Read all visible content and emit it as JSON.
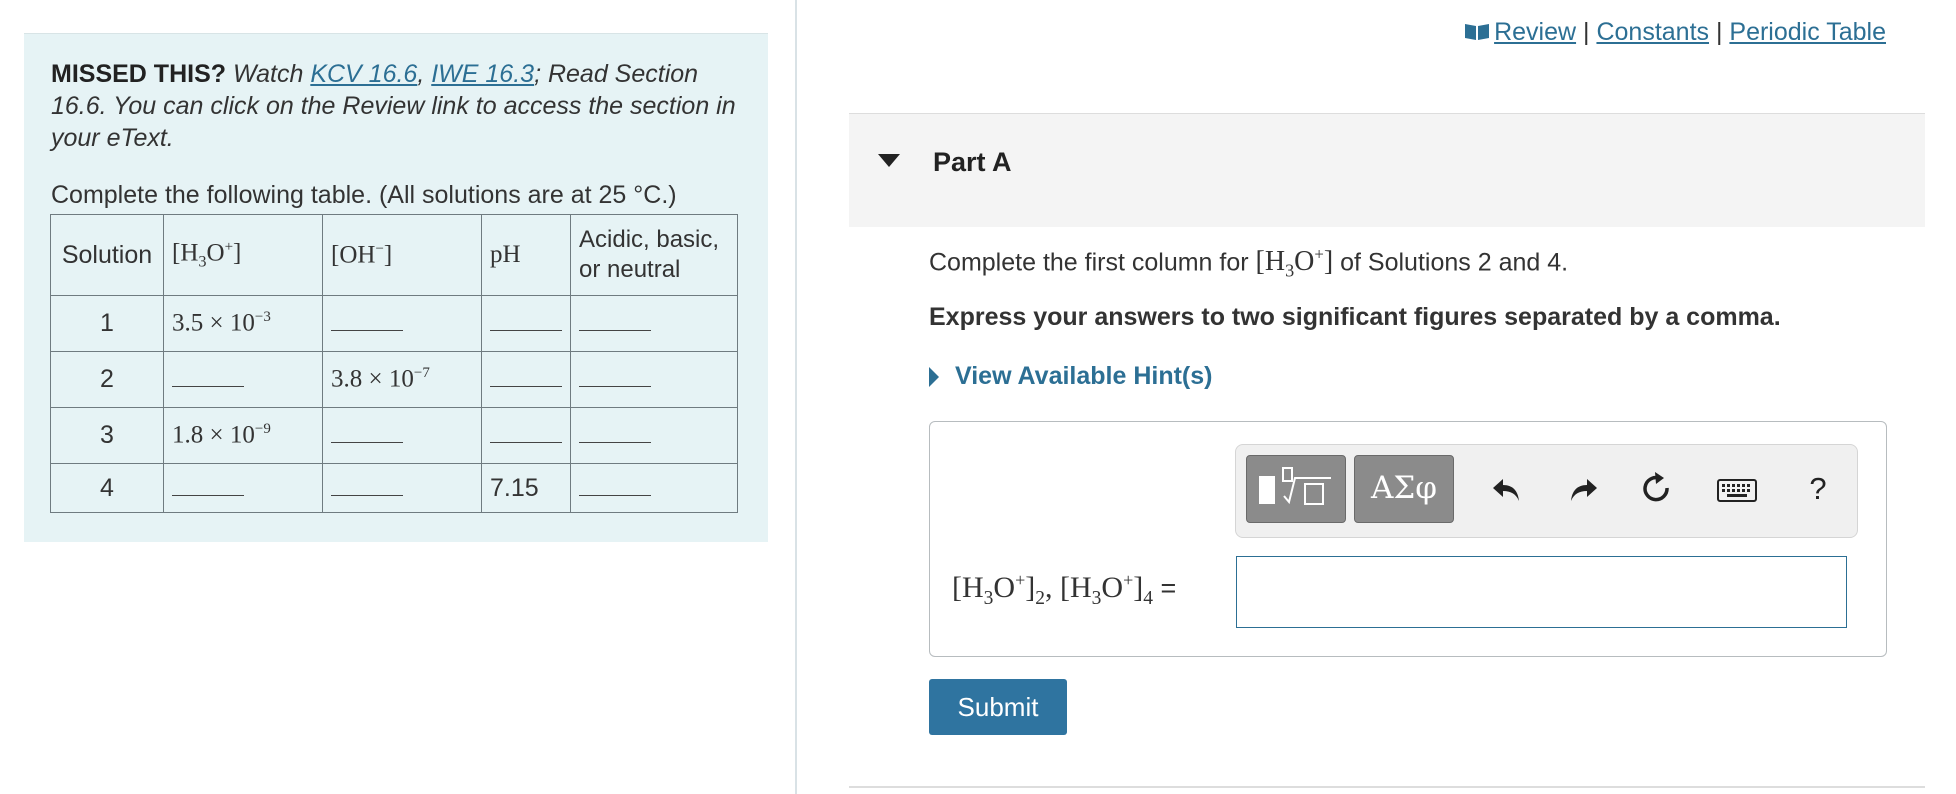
{
  "missed": {
    "prefix": "MISSED THIS?",
    "watch": " Watch ",
    "link1": "KCV 16.6",
    "sep": ", ",
    "link2": "IWE 16.3",
    "rest": "; Read Section 16.6. You can click on the Review link to access the section in your eText."
  },
  "instruction": "Complete the following table. (All solutions are at 25 °C.)",
  "table": {
    "headers": {
      "solution": "Solution",
      "h3o": "[H3O+]",
      "oh": "[OH−]",
      "ph": "pH",
      "acid": "Acidic, basic, or neutral"
    },
    "rows": [
      {
        "solution": "1",
        "h3o": "3.5 × 10−3",
        "oh": "",
        "ph": "",
        "acid": ""
      },
      {
        "solution": "2",
        "h3o": "",
        "oh": "3.8 × 10−7",
        "ph": "",
        "acid": ""
      },
      {
        "solution": "3",
        "h3o": "1.8 × 10−9",
        "oh": "",
        "ph": "",
        "acid": ""
      },
      {
        "solution": "4",
        "h3o": "",
        "oh": "",
        "ph": "7.15",
        "acid": ""
      }
    ]
  },
  "top_links": {
    "review": "Review",
    "constants": "Constants",
    "periodic": "Periodic Table",
    "sep": " | "
  },
  "part": {
    "title": "Part A"
  },
  "question": {
    "prefix": "Complete the first column for ",
    "suffix": " of Solutions 2 and 4.",
    "express": "Express your answers to two significant figures separated by a comma.",
    "hints": "View Available Hint(s)"
  },
  "answer": {
    "greek_label": "ΑΣφ",
    "help_label": "?",
    "equals": "="
  },
  "submit": "Submit",
  "colors": {
    "accent": "#2c6f94",
    "panel_bg": "#e6f3f5",
    "submit_bg": "#2f74a0"
  }
}
